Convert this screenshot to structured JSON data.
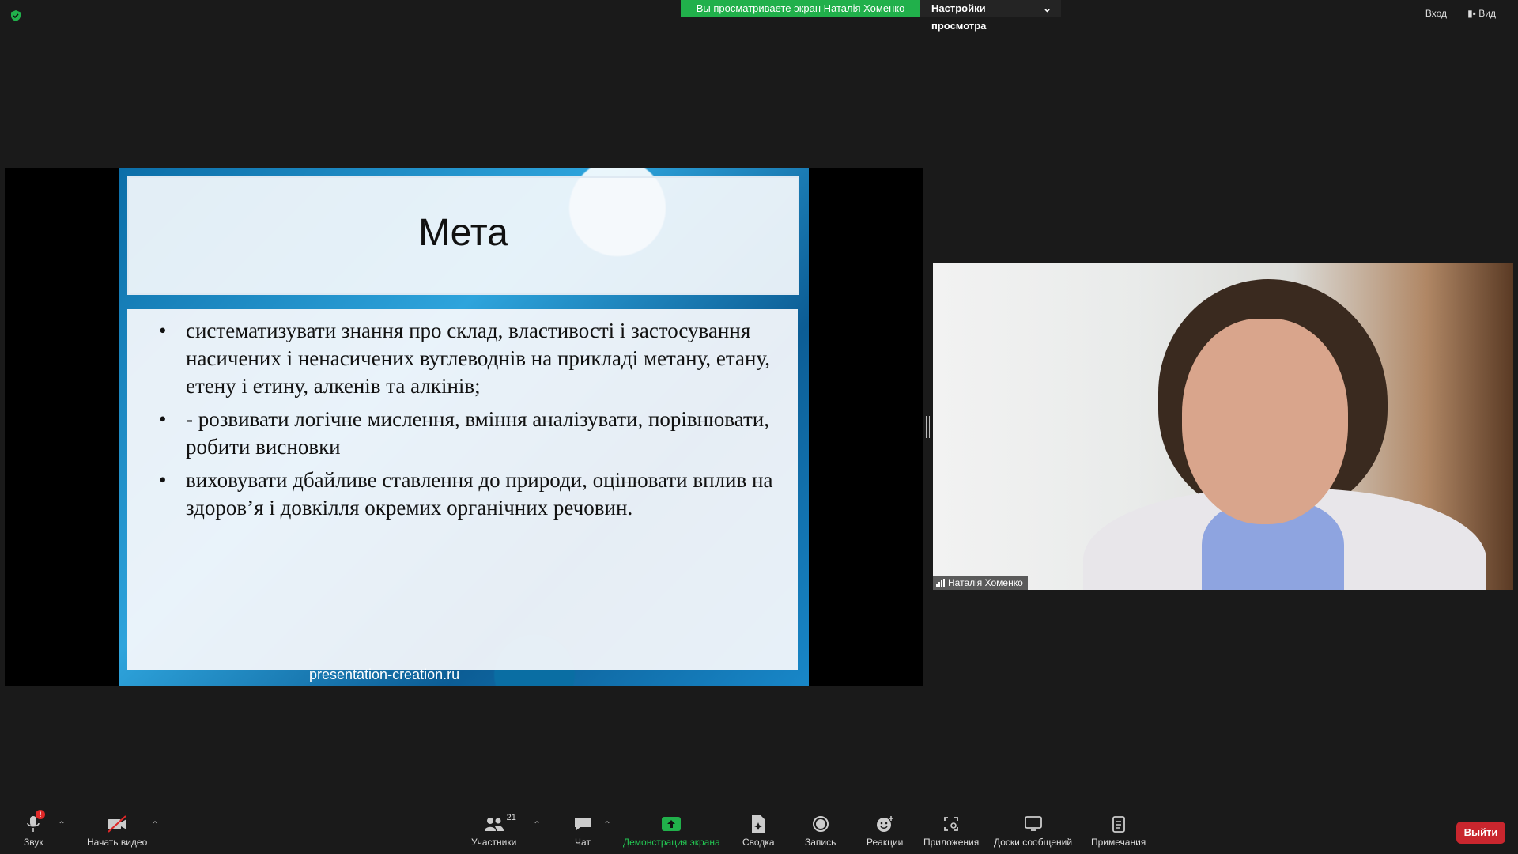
{
  "top": {
    "banner_text": "Вы просматриваете экран Наталія Хоменко",
    "view_settings": "Настройки просмотра",
    "signin": "Вход",
    "view": "Вид"
  },
  "slide": {
    "title": "Мета",
    "bullets": [
      "систематизувати знання  про склад, властивості і застосування насичених і ненасичених вуглеводнів на прикладі метану, етану, етену і етину, алкенів та алкінів;",
      "- розвивати логічне мислення, вміння аналізувати, порівнювати, робити висновки",
      "виховувати дбайливе ставлення до природи, оцінювати вплив на здоров’я і довкілля окремих органічних речовин."
    ],
    "footer": "presentation-creation.ru"
  },
  "participant": {
    "name": "Наталія Хоменко"
  },
  "toolbar": {
    "audio": "Звук",
    "audio_badge": "!",
    "video": "Начать видео",
    "participants": "Участники",
    "participants_count": "21",
    "chat": "Чат",
    "share": "Демонстрация экрана",
    "summary": "Сводка",
    "record": "Запись",
    "reactions": "Реакции",
    "apps": "Приложения",
    "whiteboards": "Доски сообщений",
    "notes": "Примечания",
    "leave": "Выйти"
  },
  "colors": {
    "share_green": "#21b04b",
    "leave_red": "#c9262e"
  }
}
